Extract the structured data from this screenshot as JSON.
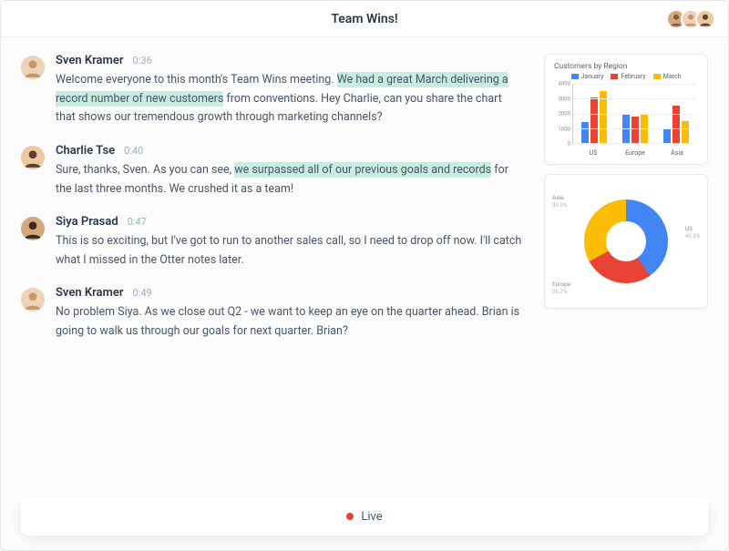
{
  "colors": {
    "blue": "#4285f4",
    "red": "#ea4335",
    "yellow": "#fbbc04"
  },
  "header": {
    "title": "Team Wins!"
  },
  "participants": [
    {
      "name": "Siya Prasad"
    },
    {
      "name": "Sven Kramer"
    },
    {
      "name": "Charlie Tse"
    }
  ],
  "transcript": [
    {
      "speaker": "Sven Kramer",
      "time": "0:36",
      "segments": [
        {
          "t": "Welcome everyone to this month's Team Wins meeting. ",
          "hl": false
        },
        {
          "t": "We had a great March delivering a record number of new customers",
          "hl": true
        },
        {
          "t": " from conventions. Hey Charlie, can you share the chart that shows our tremendous growth through marketing channels?",
          "hl": false
        }
      ]
    },
    {
      "speaker": "Charlie Tse",
      "time": "0:40",
      "segments": [
        {
          "t": "Sure, thanks, Sven. As you can see, ",
          "hl": false
        },
        {
          "t": "we surpassed all of our previous goals and records",
          "hl": true
        },
        {
          "t": " for the last three months. We crushed it as a team!",
          "hl": false
        }
      ]
    },
    {
      "speaker": "Siya Prasad",
      "time": "0:47",
      "segments": [
        {
          "t": "This is so exciting, but I've got to run to another sales call, so I need to drop off now. I'll catch what I missed in the Otter notes later.",
          "hl": false
        }
      ]
    },
    {
      "speaker": "Sven Kramer",
      "time": "0:49",
      "segments": [
        {
          "t": "No problem Siya. As we close out Q2 - we want to keep an eye on the quarter ahead. Brian is going to walk us through our goals for next quarter. Brian?",
          "hl": false
        }
      ]
    }
  ],
  "chart_data": [
    {
      "type": "bar",
      "title": "Customers by Region",
      "categories": [
        "US",
        "Europe",
        "Asia"
      ],
      "series": [
        {
          "name": "January",
          "color": "blue",
          "values": [
            1400,
            2000,
            900
          ]
        },
        {
          "name": "February",
          "color": "red",
          "values": [
            3100,
            1800,
            2500
          ]
        },
        {
          "name": "March",
          "color": "yellow",
          "values": [
            3500,
            2000,
            1500
          ]
        }
      ],
      "ylim": [
        0,
        4000
      ],
      "yticks": [
        0,
        1000,
        2000,
        3000,
        4000
      ]
    },
    {
      "type": "pie",
      "slices": [
        {
          "label": "US",
          "value": 40.3,
          "color": "blue"
        },
        {
          "label": "Europe",
          "value": 26.7,
          "color": "red"
        },
        {
          "label": "Asia",
          "value": 33.0,
          "color": "yellow"
        }
      ]
    }
  ],
  "live": {
    "label": "Live"
  }
}
